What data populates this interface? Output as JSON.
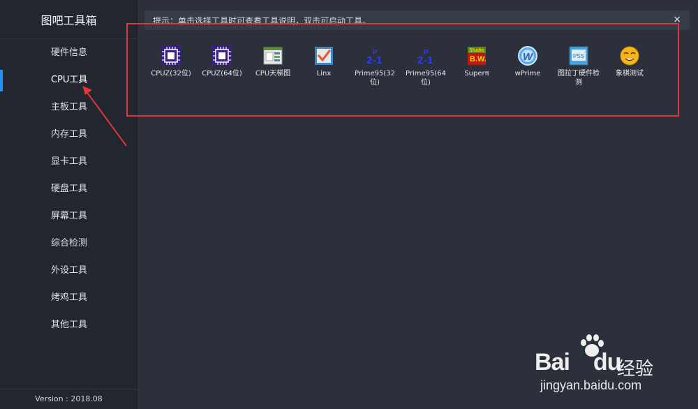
{
  "app": {
    "title": "图吧工具箱",
    "version": "Version : 2018.08"
  },
  "sidebar": {
    "items": [
      {
        "label": "硬件信息",
        "active": false
      },
      {
        "label": "CPU工具",
        "active": true
      },
      {
        "label": "主板工具",
        "active": false
      },
      {
        "label": "内存工具",
        "active": false
      },
      {
        "label": "显卡工具",
        "active": false
      },
      {
        "label": "硬盘工具",
        "active": false
      },
      {
        "label": "屏幕工具",
        "active": false
      },
      {
        "label": "综合检测",
        "active": false
      },
      {
        "label": "外设工具",
        "active": false
      },
      {
        "label": "烤鸡工具",
        "active": false
      },
      {
        "label": "其他工具",
        "active": false
      }
    ]
  },
  "hint": {
    "text": "提示：单击选择工具时可查看工具说明，双击可启动工具。",
    "close": "×"
  },
  "tools": [
    {
      "label": "CPUZ(32位)",
      "icon": "cpuz-icon"
    },
    {
      "label": "CPUZ(64位)",
      "icon": "cpuz-icon"
    },
    {
      "label": "CPU天梯图",
      "icon": "cpu-ladder-icon"
    },
    {
      "label": "Linx",
      "icon": "linx-icon"
    },
    {
      "label": "Prime95(32位)",
      "icon": "prime95-icon"
    },
    {
      "label": "Prime95(64位)",
      "icon": "prime95-icon"
    },
    {
      "label": "Superπ",
      "icon": "superpi-icon"
    },
    {
      "label": "wPrime",
      "icon": "wprime-icon"
    },
    {
      "label": "图拉丁硬件检测",
      "icon": "tulading-icon"
    },
    {
      "label": "象棋测试",
      "icon": "chess-face-icon"
    }
  ],
  "watermark": {
    "brand": "Bai",
    "brand2": "du",
    "jingyan": "经验",
    "url": "jingyan.baidu.com"
  },
  "colors": {
    "accent": "#1e90ff",
    "annotation": "#e0353a",
    "sidebar_bg": "#22262f",
    "main_bg": "#2b303b"
  }
}
